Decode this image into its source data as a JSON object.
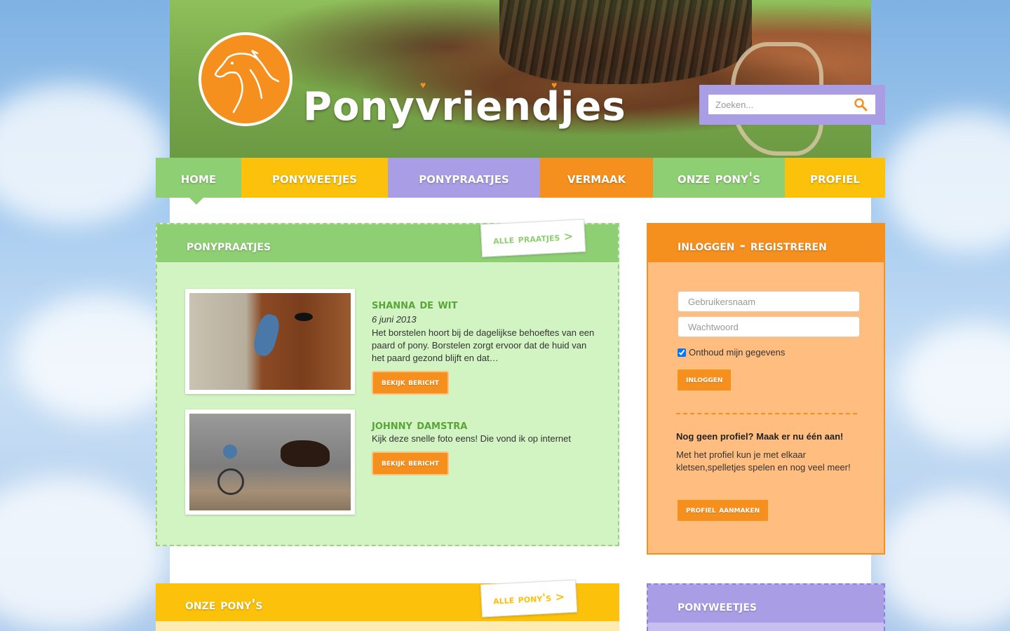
{
  "site": {
    "brand": "Ponyvriendjes"
  },
  "search": {
    "placeholder": "Zoeken..."
  },
  "nav": [
    {
      "label": "Home",
      "color": "#8fcf73"
    },
    {
      "label": "Ponyweetjes",
      "color": "#fcc10a"
    },
    {
      "label": "Ponypraatjes",
      "color": "#a99ee6"
    },
    {
      "label": "Vermaak",
      "color": "#f5901e"
    },
    {
      "label": "Onze pony's",
      "color": "#8fcf73"
    },
    {
      "label": "Profiel",
      "color": "#fcc10a"
    }
  ],
  "ponypraatjes": {
    "title": "Ponypraatjes",
    "all_link": "Alle praatjes >",
    "posts": [
      {
        "author": "Shanna de Wit",
        "date": "6 juni 2013",
        "text": "Het borstelen hoort bij de dagelijkse behoeftes van een paard of pony. Borstelen zorgt ervoor dat de huid van het paard gezond blijft en dat…",
        "button": "Bekijk bericht"
      },
      {
        "author": "Johnny Damstra",
        "date": "",
        "text": "Kijk deze snelle foto eens! Die vond ik op internet",
        "button": "Bekijk bericht"
      }
    ]
  },
  "login": {
    "title": "Inloggen - Registreren",
    "username_placeholder": "Gebruikersnaam",
    "password_placeholder": "Wachtwoord",
    "remember_label": "Onthoud mijn gegevens",
    "login_button": "Inloggen",
    "register_heading": "Nog geen profiel? Maak er nu één aan!",
    "register_text": "Met het profiel kun je met elkaar kletsen,spelletjes spelen en nog veel meer!",
    "register_button": "Profiel aanmaken"
  },
  "onze_ponys": {
    "title": "Onze pony's",
    "all_link": "Alle pony's >"
  },
  "ponyweetjes": {
    "title": "Ponyweetjes"
  },
  "colors": {
    "green": "#8fcf73",
    "green_light": "#d2f4c2",
    "yellow": "#fcc10a",
    "purple": "#a99ee6",
    "orange": "#f5901e",
    "orange_light": "#ffbd80"
  }
}
